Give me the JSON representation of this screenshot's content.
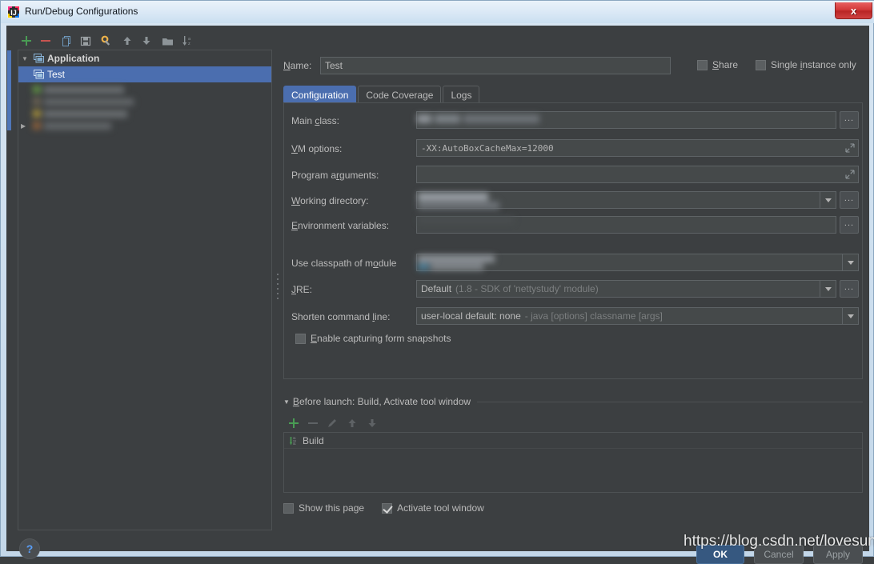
{
  "window": {
    "title": "Run/Debug Configurations",
    "icon": "intellij-idea-logo-icon",
    "close_label": "x"
  },
  "colors": {
    "accent_selection": "#4b6eaf",
    "dialog_background": "#3c3f41",
    "field_background": "#45494a",
    "text_primary": "#bbbbbb",
    "text_muted": "#7c7f80",
    "ok_button": "#365880",
    "add_icon_green": "#499c54",
    "remove_icon_red": "#c75450",
    "close_button_red": "#d33a3a",
    "help_blue": "#589df6"
  },
  "sidebar": {
    "toolbar": [
      {
        "name": "add-configuration-button",
        "icon": "plus-icon",
        "glyph": "+"
      },
      {
        "name": "remove-configuration-button",
        "icon": "minus-icon",
        "glyph": "−"
      },
      {
        "name": "copy-configuration-button",
        "icon": "copy-icon",
        "glyph": "❐"
      },
      {
        "name": "save-configuration-button",
        "icon": "save-floppy-icon",
        "glyph": "▣"
      },
      {
        "name": "edit-templates-button",
        "icon": "wrench-gear-icon",
        "glyph": "⚙"
      },
      {
        "name": "move-up-button",
        "icon": "arrow-up-icon",
        "glyph": "↑"
      },
      {
        "name": "move-down-button",
        "icon": "arrow-down-icon",
        "glyph": "↓"
      },
      {
        "name": "create-folder-button",
        "icon": "folder-icon",
        "glyph": "▬"
      },
      {
        "name": "sort-configurations-button",
        "icon": "sort-alphabetical-icon",
        "glyph": "↓az"
      }
    ],
    "tree": [
      {
        "label": "Application",
        "type": "group",
        "icon": "application-run-icon",
        "expanded": true,
        "arrow": "▼",
        "selected": false
      },
      {
        "label": "Test",
        "type": "item",
        "icon": "application-run-icon",
        "selected": true
      }
    ],
    "blurred_item_count": 4,
    "collapsed_arrow": "▶"
  },
  "header": {
    "name_label_pre": "N",
    "name_label_post": "ame:",
    "name_value": "Test",
    "share": {
      "label_pre": "S",
      "label_post": "hare",
      "checked": false
    },
    "single_instance": {
      "label_pre": "Single ",
      "label_u": "i",
      "label_post": "nstance only",
      "checked": false
    }
  },
  "tabs": [
    {
      "label": "Configuration",
      "active": true,
      "name": "tab-configuration"
    },
    {
      "label": "Code Coverage",
      "active": false,
      "name": "tab-code-coverage"
    },
    {
      "label": "Logs",
      "active": false,
      "name": "tab-logs"
    }
  ],
  "configuration": {
    "fields": [
      {
        "name": "main-class",
        "label_pre": "Main ",
        "label_u": "c",
        "label_post": "lass:",
        "value": "",
        "blurred": true,
        "has_browse": true,
        "browse_label": "..."
      },
      {
        "name": "vm-options",
        "label_u": "V",
        "label_post": "M options:",
        "value": "-XX:AutoBoxCacheMax=12000",
        "mono": true,
        "has_expand": true
      },
      {
        "name": "program-arguments",
        "label_pre": "Program a",
        "label_u": "r",
        "label_post": "guments:",
        "value": "",
        "has_expand": true
      },
      {
        "name": "working-directory",
        "label_u": "W",
        "label_post": "orking directory:",
        "value": "",
        "blurred": true,
        "has_dropdown": true,
        "has_browse": true,
        "browse_label": "..."
      },
      {
        "name": "environment-variables",
        "label_u": "E",
        "label_post": "nvironment variables:",
        "value": "",
        "has_browse": true,
        "browse_label": "..."
      },
      {
        "name": "use-classpath-of-module",
        "label_pre": "Use classpath of m",
        "label_u": "o",
        "label_post": "dule",
        "value": "",
        "blurred": true,
        "has_dropdown": true
      },
      {
        "name": "jre",
        "label_u": "J",
        "label_post": "RE:",
        "value_strong": "Default",
        "value_muted": "(1.8 - SDK of 'nettystudy' module)",
        "has_dropdown": true,
        "has_browse": true,
        "browse_label": "..."
      },
      {
        "name": "shorten-command-line",
        "label_pre": "Shorten command ",
        "label_u": "l",
        "label_post": "ine:",
        "value_strong": "user-local default: none",
        "value_muted": "- java [options] classname [args]",
        "has_dropdown": true
      }
    ],
    "enable_snapshots": {
      "label_pre": "",
      "label_u": "E",
      "label_post": "nable capturing form snapshots",
      "checked": false
    }
  },
  "before_launch": {
    "twisty": "▼",
    "title_pre": "B",
    "title_u": "",
    "title_post": "efore launch: Build, Activate tool window",
    "toolbar": [
      {
        "name": "bl-add-button",
        "icon": "plus-icon",
        "glyph": "+",
        "enabled": true
      },
      {
        "name": "bl-remove-button",
        "icon": "minus-icon",
        "glyph": "−",
        "enabled": false
      },
      {
        "name": "bl-edit-button",
        "icon": "pencil-icon",
        "glyph": "✎",
        "enabled": false
      },
      {
        "name": "bl-move-up-button",
        "icon": "arrow-up-icon",
        "glyph": "↑",
        "enabled": false
      },
      {
        "name": "bl-move-down-button",
        "icon": "arrow-down-icon",
        "glyph": "↓",
        "enabled": false
      }
    ],
    "items": [
      {
        "label": "Build",
        "icon": "compile-build-icon"
      }
    ],
    "show_this_page": {
      "label": "Show this page",
      "checked": false
    },
    "activate_tool_window": {
      "label": "Activate tool window",
      "checked": true
    }
  },
  "footer": {
    "help_glyph": "?",
    "ok_label": "OK",
    "cancel_label": "Cancel",
    "apply_label": "Apply"
  },
  "watermark": {
    "text": "https://blog.csdn.net/lovesunren"
  }
}
